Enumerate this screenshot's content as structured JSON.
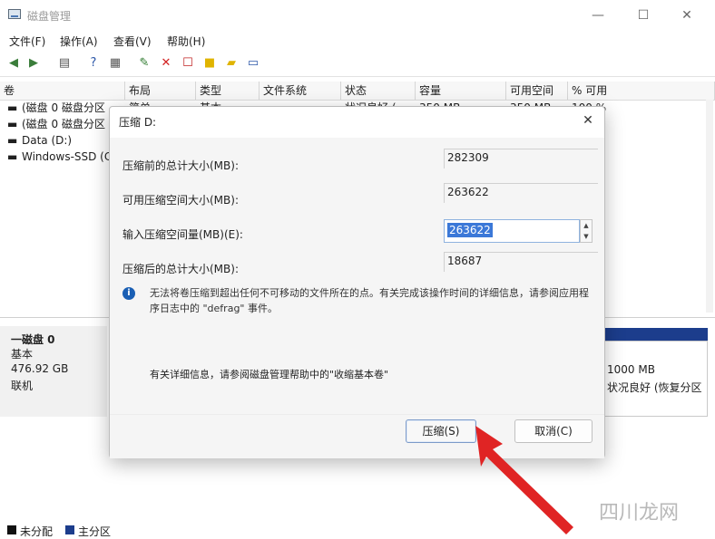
{
  "window": {
    "title": "磁盘管理",
    "min_glyph": "—",
    "max_glyph": "☐",
    "close_glyph": "✕"
  },
  "menu": [
    "文件(F)",
    "操作(A)",
    "查看(V)",
    "帮助(H)"
  ],
  "toolbar_icons": [
    "back-icon",
    "forward-icon",
    "console-icon",
    "help-icon",
    "properties-icon",
    "connect-icon",
    "delete-icon",
    "new-icon",
    "folder-icon",
    "open-icon",
    "view-icon"
  ],
  "list": {
    "columns": [
      "卷",
      "布局",
      "类型",
      "文件系统",
      "状态",
      "容量",
      "可用空间",
      "% 可用"
    ],
    "rows": [
      {
        "name": "(磁盘 0 磁盘分区",
        "layout": "简单",
        "type": "基本",
        "fs": "",
        "status": "状况良好 (",
        "capacity": "350 MB",
        "free": "350 MB",
        "pct": "100 %"
      },
      {
        "name": "(磁盘 0 磁盘分区",
        "layout": "",
        "type": "",
        "fs": "",
        "status": "",
        "capacity": "",
        "free": "",
        "pct": ""
      },
      {
        "name": "Data (D:)",
        "layout": "",
        "type": "",
        "fs": "",
        "status": "",
        "capacity": "",
        "free": "",
        "pct": ""
      },
      {
        "name": "Windows-SSD (C",
        "layout": "",
        "type": "",
        "fs": "",
        "status": "",
        "capacity": "",
        "free": "",
        "pct": ""
      }
    ]
  },
  "disk": {
    "name": "一磁盘 0",
    "type": "基本",
    "size": "476.92 GB",
    "status": "联机"
  },
  "partition": {
    "size": "1000 MB",
    "status": "状况良好 (恢复分区"
  },
  "legend": [
    "未分配",
    "主分区"
  ],
  "dialog": {
    "title": "压缩 D:",
    "close_glyph": "✕",
    "label_total_before": "压缩前的总计大小(MB):",
    "value_total_before": "282309",
    "label_available": "可用压缩空间大小(MB):",
    "value_available": "263622",
    "label_input": "输入压缩空间量(MB)(E):",
    "value_input": "263622",
    "label_total_after": "压缩后的总计大小(MB):",
    "value_total_after": "18687",
    "info_text": "无法将卷压缩到超出任何不可移动的文件所在的点。有关完成该操作时间的详细信息，请参阅应用程序日志中的 \"defrag\" 事件。",
    "help_text": "有关详细信息，请参阅磁盘管理帮助中的\"收缩基本卷\"",
    "primary_button": "压缩(S)",
    "cancel_button": "取消(C)"
  },
  "watermark": "四川龙网",
  "colors": {
    "accent": "#1c3d8c",
    "selection": "#3b78d8",
    "arrow": "#e02424",
    "unallocated": "#111111",
    "primary": "#1c3d8c"
  }
}
